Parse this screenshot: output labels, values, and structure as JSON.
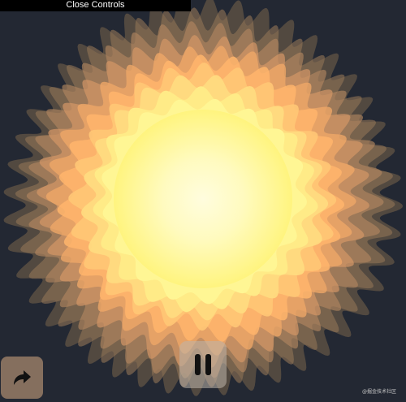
{
  "controls": {
    "toggle_label": "Close Controls"
  },
  "buttons": {
    "share_icon": "share-arrow-icon",
    "pause_icon": "pause-icon"
  },
  "watermark": {
    "text": "@掘金技术社区"
  },
  "colors": {
    "background": "#232833",
    "core": "#fffde6",
    "inner": "#fff694",
    "middle": "#ffd87c",
    "outer": "#ffa961"
  }
}
